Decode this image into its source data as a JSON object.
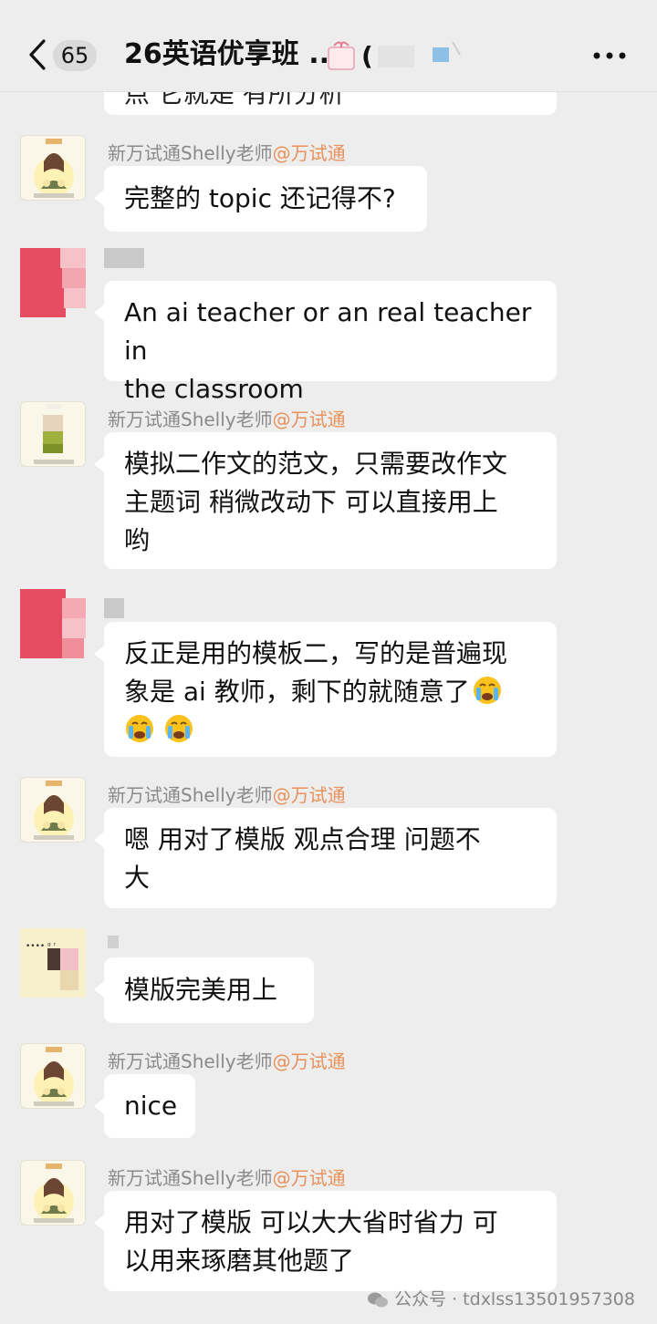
{
  "header": {
    "back_label": "",
    "unread_count": "65",
    "title": "26英语优享班 ..."
  },
  "teacher": {
    "name": "新万试通Shelly老师",
    "tag": "@万试通",
    "avatar_caption": "万试通考试助教 Shelly"
  },
  "messages": [
    {
      "text_lines": [
        "点 它就是 有所分析"
      ]
    },
    {
      "text_lines": [
        "完整的 topic 还记得不?"
      ]
    },
    {
      "text_lines": [
        "An ai teacher or an real teacher in",
        "the classroom"
      ]
    },
    {
      "text_lines": [
        "模拟二作文的范文，只需要改作文",
        "主题词 稍微改动下 可以直接用上",
        "哟"
      ]
    },
    {
      "text_lines": [
        "反正是用的模板二，写的是普遍现",
        "象是 ai 教师，剩下的就随意了"
      ]
    },
    {
      "text_lines": [
        "嗯 用对了模版  观点合理  问题不",
        "大"
      ]
    },
    {
      "text_lines": [
        "模版完美用上"
      ]
    },
    {
      "text_lines": [
        "nice"
      ]
    },
    {
      "text_lines": [
        "用对了模版 可以大大省时省力 可",
        "以用来琢磨其他题了"
      ]
    }
  ],
  "emoji": {
    "name": "loudly-crying-face-icon",
    "count": 3
  },
  "watermark": "公众号 · tdxlss13501957308",
  "colors": {
    "background": "#ededed",
    "bubble": "#ffffff",
    "sender_gray": "#8a8a8a",
    "tag_orange": "#e8915a",
    "pink_avatar": "#e64d63"
  }
}
